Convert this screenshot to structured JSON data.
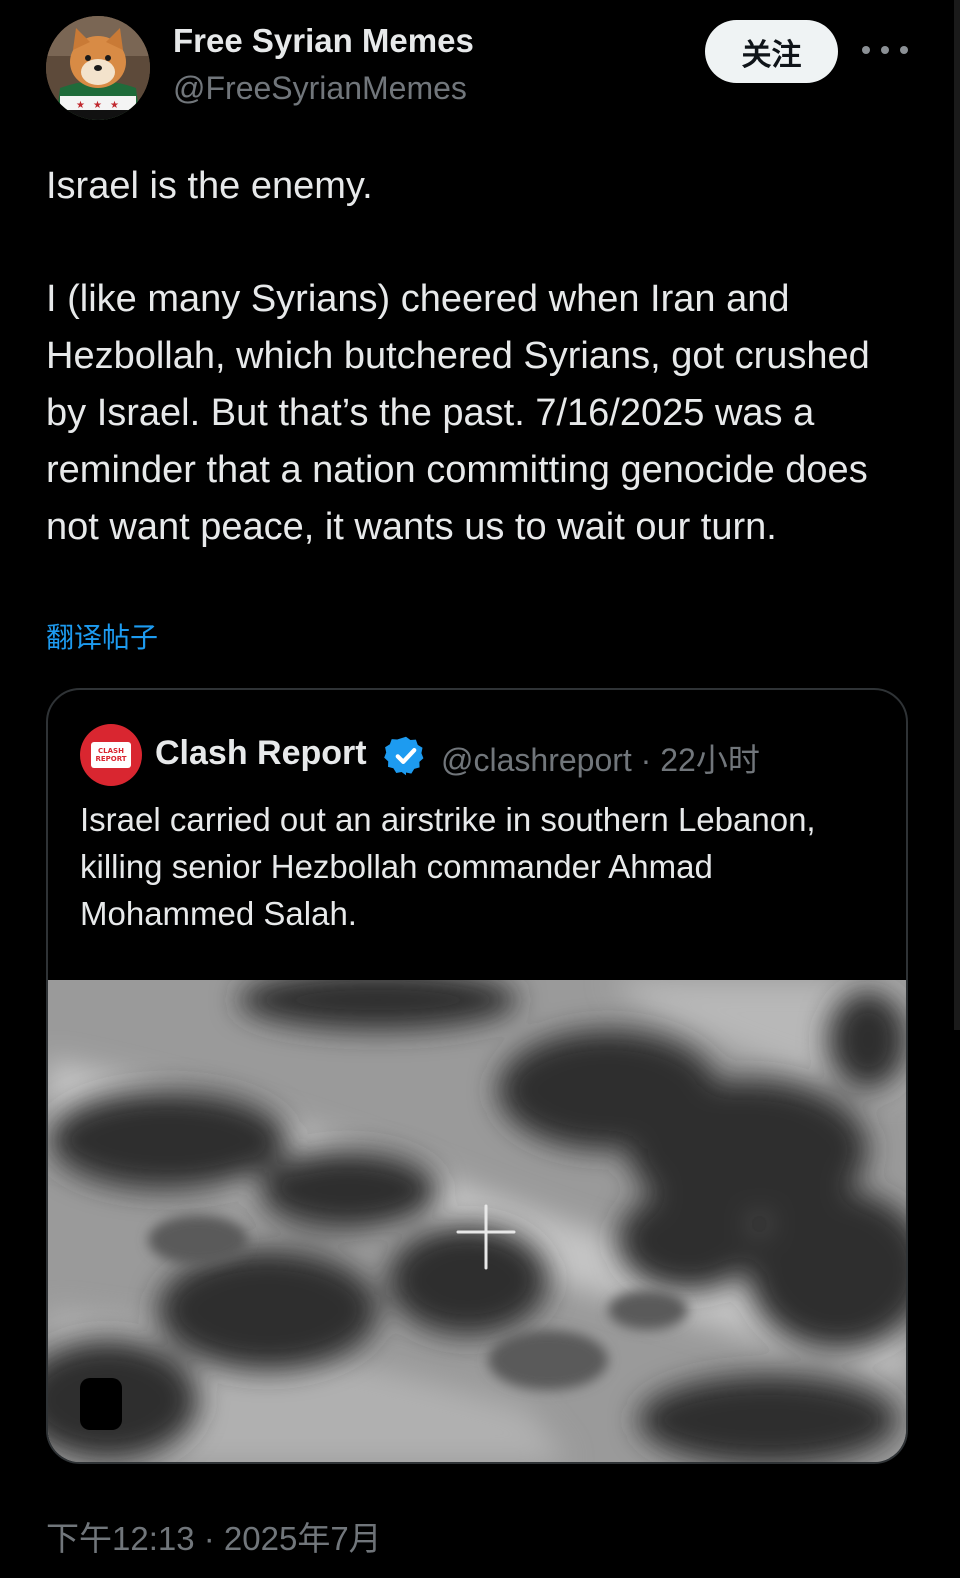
{
  "author": {
    "display_name": "Free Syrian Memes",
    "handle": "@FreeSyrianMemes",
    "avatar_icon": "shiba-dog-avatar"
  },
  "actions": {
    "follow_label": "关注",
    "more_icon": "more-horizontal-icon"
  },
  "tweet": {
    "paragraph_1": "Israel is the enemy.",
    "paragraph_2": "I (like many Syrians) cheered when Iran and Hezbollah, which butchered Syrians, got crushed by Israel. But that’s the past. 7/16/2025 was a reminder that a nation committing genocide does not want peace, it wants us to wait our turn.",
    "translate_label": "翻译帖子"
  },
  "quoted_tweet": {
    "display_name": "Clash Report",
    "handle_and_time": "@clashreport · 22小时",
    "text": "Israel carried out an airstrike in southern Lebanon, killing senior Hezbollah commander Ahmad Mohammed Salah.",
    "avatar_line_1": "CLASH",
    "avatar_line_2": "REPORT",
    "verified_icon": "verified-badge-icon",
    "verified_color": "#1d9bf0",
    "media_type": "video"
  },
  "footer": {
    "timestamp": "下午12:13 · 2025年7月"
  },
  "colors": {
    "background": "#000000",
    "text_primary": "#e7e9ea",
    "text_secondary": "#71767b",
    "link": "#1d9bf0",
    "border": "#2f3336"
  }
}
